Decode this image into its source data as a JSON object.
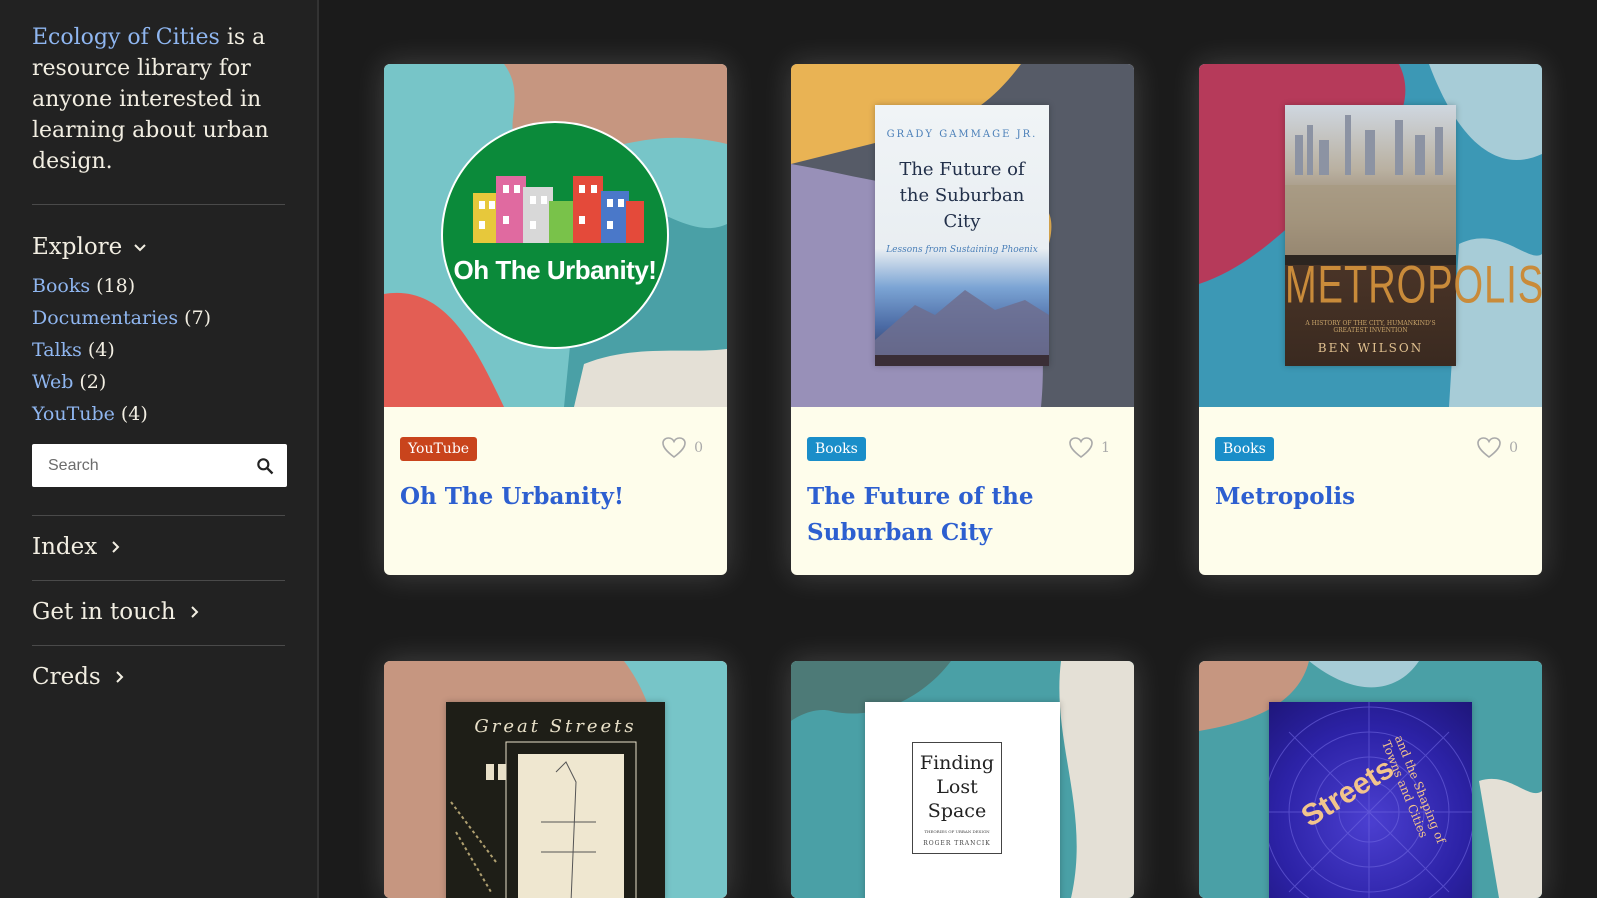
{
  "sidebar": {
    "brand": "Ecology of Cities",
    "intro_rest": " is a resource library for anyone interested in learning about urban design.",
    "explore_label": "Explore",
    "categories": [
      {
        "label": "Books",
        "count": "(18)"
      },
      {
        "label": "Documentaries",
        "count": "(7)"
      },
      {
        "label": "Talks",
        "count": "(4)"
      },
      {
        "label": "Web",
        "count": "(2)"
      },
      {
        "label": "YouTube",
        "count": "(4)"
      }
    ],
    "search_placeholder": "Search",
    "sections": [
      "Index",
      "Get in touch",
      "Creds"
    ]
  },
  "cards": [
    {
      "tag": "YouTube",
      "likes": "0",
      "title": "Oh The Urbanity!",
      "logo_text": "Oh The Urbanity!"
    },
    {
      "tag": "Books",
      "likes": "1",
      "title": "The Future of the Suburban City",
      "cover_author": "GRADY GAMMAGE JR.",
      "cover_title": "The Future of the Suburban City",
      "cover_subtitle": "Lessons from Sustaining Phoenix"
    },
    {
      "tag": "Books",
      "likes": "0",
      "title": "Metropolis",
      "cover_title": "METROPOLIS",
      "cover_subtitle": "A HISTORY OF THE CITY, HUMANKIND'S GREATEST INVENTION",
      "cover_author": "BEN WILSON"
    },
    {
      "cover_title": "Great Streets"
    },
    {
      "cover_title": "Finding Lost Space",
      "cover_subtitle": "THEORIES OF URBAN DESIGN",
      "cover_author": "ROGER TRANCIK"
    },
    {
      "cover_title": "Streets",
      "cover_subtitle": "and the Shaping of Towns and Cities"
    }
  ],
  "colors": {
    "tag_youtube": "#c9441c",
    "tag_books": "#1a8ec9",
    "link": "#8fb6f0",
    "title": "#2d5fd0"
  }
}
